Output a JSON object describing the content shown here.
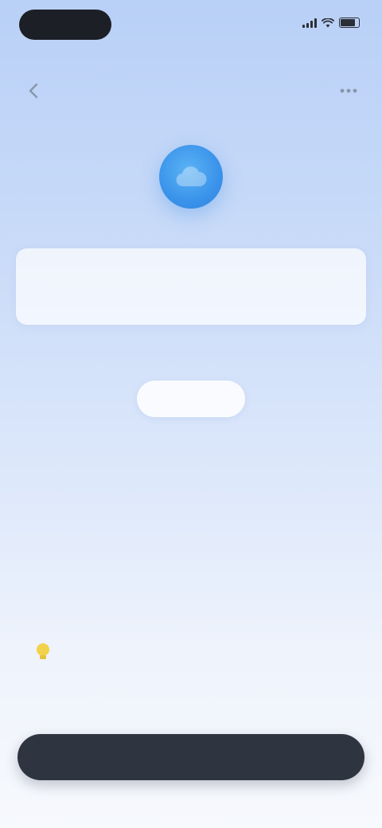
{
  "status_bar": {
    "time": "",
    "icons": [
      "signal-icon",
      "wifi-icon",
      "battery-icon"
    ]
  },
  "nav": {
    "back_icon": "chevron-left-icon",
    "help_icon": "more-icon"
  },
  "app_icon": {
    "name": "app-logo-icon",
    "color": "#3a93ea"
  },
  "info_card": {
    "line1": "",
    "line2": ""
  },
  "sub_text": "",
  "small_button": {
    "label": ""
  },
  "tip": {
    "icon": "lightbulb-icon",
    "icon_color": "#f2d24b",
    "title": "",
    "body": ""
  },
  "main_button": {
    "label": ""
  },
  "colors": {
    "accent": "#3a93ea",
    "button_dark": "#2f3540",
    "bg_top": "#b9d0f7",
    "bg_bottom": "#f7f9fd"
  }
}
